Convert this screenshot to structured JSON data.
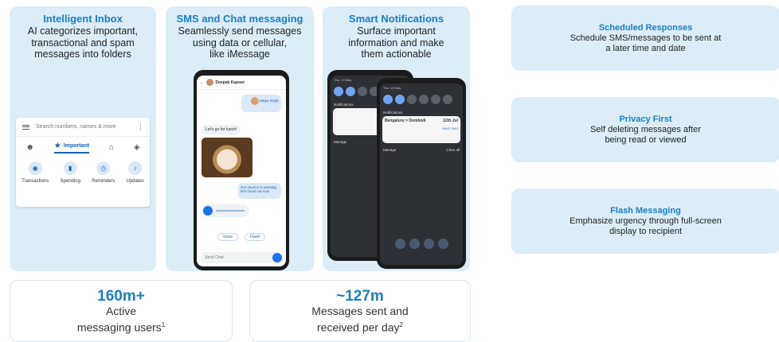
{
  "features": [
    {
      "title": "Intelligent Inbox",
      "desc": [
        "AI categorizes important,",
        "transactional and spam",
        "messages into folders"
      ]
    },
    {
      "title": "SMS and Chat messaging",
      "desc": [
        "Seamlessly send messages",
        "using data or cellular,",
        "like iMessage"
      ]
    },
    {
      "title": "Smart Notifications",
      "desc": [
        "Surface important",
        "information and make",
        "them actionable"
      ]
    }
  ],
  "inbox": {
    "search_placeholder": "Search numbers, names & more",
    "tab_active": "Important",
    "categories": [
      "Transactions",
      "Spending",
      "Reminders",
      "Updates"
    ]
  },
  "chat": {
    "contact": "Deepak Kapoor",
    "sender": "Maya Singh",
    "msg1": "Let's go for lunch!",
    "msg2": "Got stuck in a meeting, let's head out now",
    "actions": [
      "Voice",
      "Flash"
    ],
    "input_placeholder": "Send Chat"
  },
  "notif": {
    "date_back": "Thu, 13 May",
    "date_front": "Thu, 13 May",
    "header": "Notifications",
    "sender": "Bengaluru > Dombivli",
    "date_tag": "12th Jul",
    "action": "SAVE SMS",
    "manage": "Manage",
    "clear": "Clear all"
  },
  "right_cards": [
    {
      "title": "Scheduled Responses",
      "desc": [
        "Schedule SMS/messages to be sent at",
        "a later time and date"
      ]
    },
    {
      "title": "Privacy First",
      "desc": [
        "Self deleting messages after",
        "being read or viewed"
      ]
    },
    {
      "title": "Flash Messaging",
      "desc": [
        "Emphasize urgency through full-screen",
        "display to recipient"
      ]
    }
  ],
  "stats": [
    {
      "value": "160m+",
      "label": [
        "Active",
        "messaging users"
      ],
      "sup": "1"
    },
    {
      "value": "~127m",
      "label": [
        "Messages sent and",
        "received per day"
      ],
      "sup": "2"
    }
  ]
}
